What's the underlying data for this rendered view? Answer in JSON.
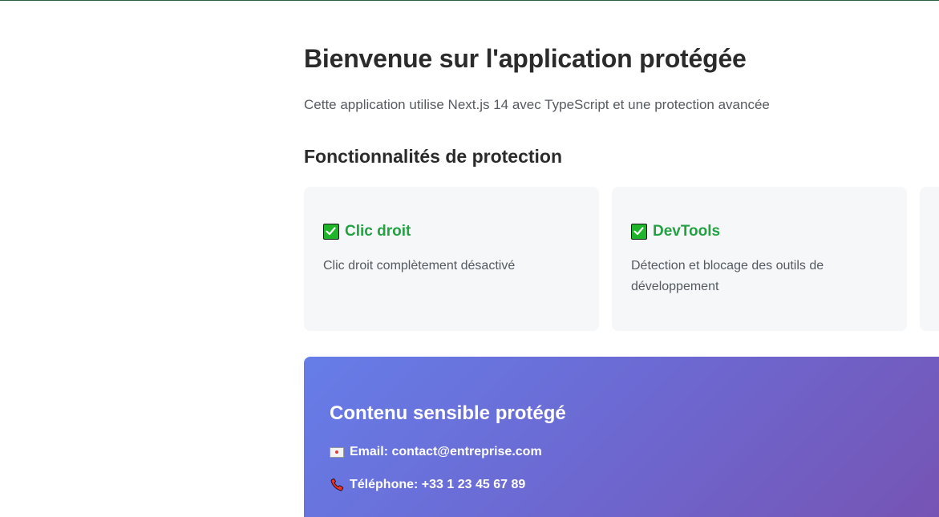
{
  "header": {
    "title": "Bienvenue sur l'application protégée",
    "subtitle": "Cette application utilise Next.js 14 avec TypeScript et une protection avancée"
  },
  "features": {
    "section_title": "Fonctionnalités de protection",
    "items": [
      {
        "icon": "check-icon",
        "title": "Clic droit",
        "description": "Clic droit complètement désactivé"
      },
      {
        "icon": "check-icon",
        "title": "DevTools",
        "description": "Détection et blocage des outils de développement"
      }
    ]
  },
  "sensitive": {
    "title": "Contenu sensible protégé",
    "email_label": "Email: contact@entreprise.com",
    "phone_label": "Téléphone: +33 1 23 45 67 89"
  },
  "colors": {
    "feature_title": "#23a143",
    "gradient_start": "#667de8",
    "gradient_end": "#7654b4",
    "card_bg": "#f6f7f9"
  }
}
